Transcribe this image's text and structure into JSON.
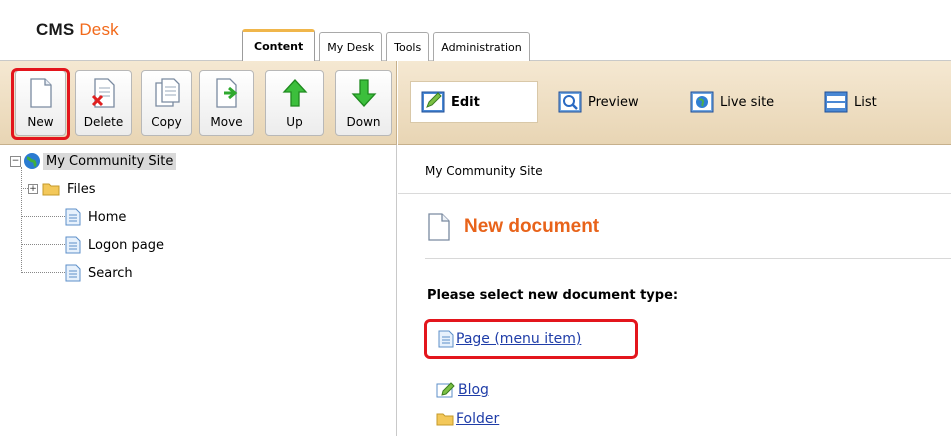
{
  "app": {
    "logo_main": "CMS",
    "logo_accent": "Desk"
  },
  "tabs": [
    {
      "label": "Content",
      "active": true
    },
    {
      "label": "My Desk",
      "active": false
    },
    {
      "label": "Tools",
      "active": false
    },
    {
      "label": "Administration",
      "active": false
    }
  ],
  "toolbar": {
    "new": "New",
    "delete": "Delete",
    "copy": "Copy",
    "move": "Move",
    "up": "Up",
    "down": "Down"
  },
  "view_modes": {
    "edit": "Edit",
    "preview": "Preview",
    "live_site": "Live site",
    "list": "List"
  },
  "tree": {
    "root": "My Community Site",
    "children": [
      "Files",
      "Home",
      "Logon page",
      "Search"
    ]
  },
  "breadcrumb": "My Community Site",
  "content": {
    "title": "New document",
    "select_label": "Please select new document type:",
    "doc_types": [
      "Page (menu item)",
      "Blog",
      "Folder"
    ]
  },
  "colors": {
    "accent": "#f26a1b",
    "highlight": "#e3151c",
    "toolbar_bg": "#efdfc3",
    "link": "#1f3da8"
  }
}
